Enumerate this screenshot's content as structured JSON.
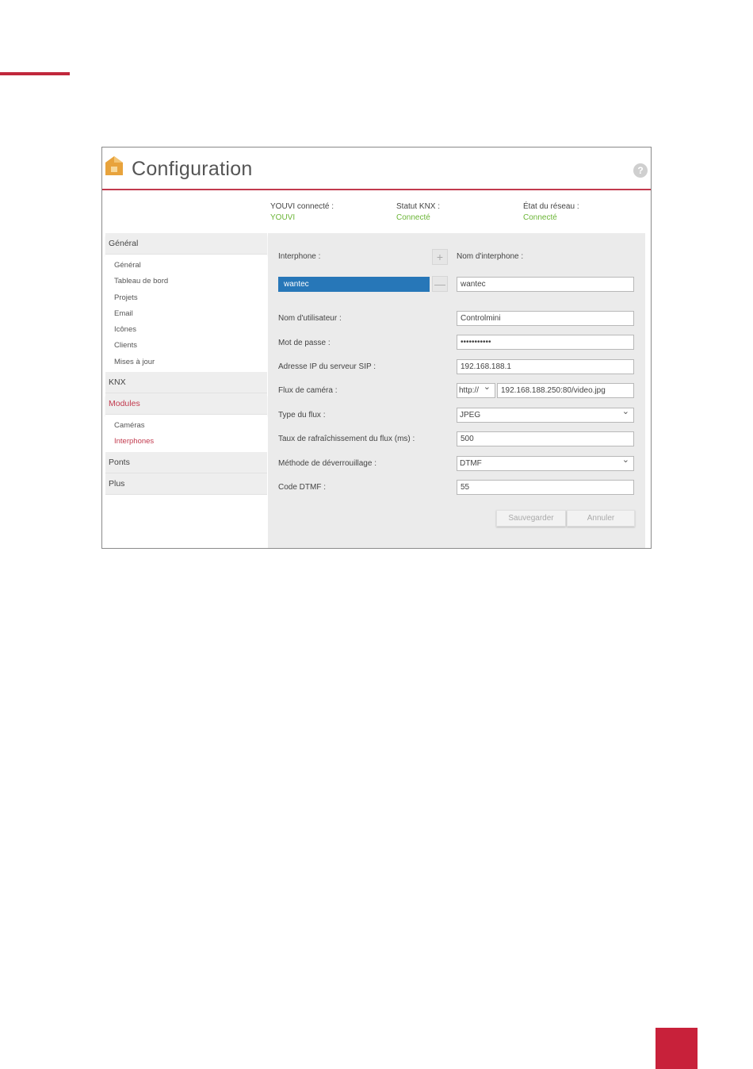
{
  "app": {
    "title": "Configuration",
    "help_label": "?"
  },
  "status": [
    {
      "label": "YOUVI connecté :",
      "value": "YOUVI"
    },
    {
      "label": "Statut KNX :",
      "value": "Connecté"
    },
    {
      "label": "État du réseau :",
      "value": "Connecté"
    }
  ],
  "sidebar": {
    "sections": [
      {
        "label": "Général",
        "items": [
          "Général",
          "Tableau de bord",
          "Projets",
          "Email",
          "Icônes",
          "Clients",
          "Mises à jour"
        ]
      },
      {
        "label": "KNX"
      },
      {
        "label": "Modules",
        "items": [
          "Caméras",
          "Interphones"
        ]
      },
      {
        "label": "Ponts"
      },
      {
        "label": "Plus"
      }
    ]
  },
  "form": {
    "interphone_label": "Interphone :",
    "add_symbol": "+",
    "remove_symbol": "—",
    "selected_interphone": "wantec",
    "name_label": "Nom d'interphone :",
    "name_value": "wantec",
    "username_label": "Nom d'utilisateur :",
    "username_value": "Controlmini",
    "password_label": "Mot de passe :",
    "password_value": "•••••••••••",
    "sip_label": "Adresse IP du serveur SIP :",
    "sip_value": "192.168.188.1",
    "camera_label": "Flux de caméra :",
    "camera_protocol": "http://",
    "camera_url": "192.168.188.250:80/video.jpg",
    "stream_type_label": "Type du flux :",
    "stream_type_value": "JPEG",
    "refresh_label": "Taux de rafraîchissement du flux (ms) :",
    "refresh_value": "500",
    "unlock_label": "Méthode de déverrouillage :",
    "unlock_value": "DTMF",
    "dtmf_label": "Code DTMF :",
    "dtmf_value": "55",
    "save_label": "Sauvegarder",
    "cancel_label": "Annuler"
  },
  "colors": {
    "accent": "#c23a4e",
    "selection": "#2777b8",
    "connected": "#6bb536",
    "logo": "#e8a33c"
  }
}
